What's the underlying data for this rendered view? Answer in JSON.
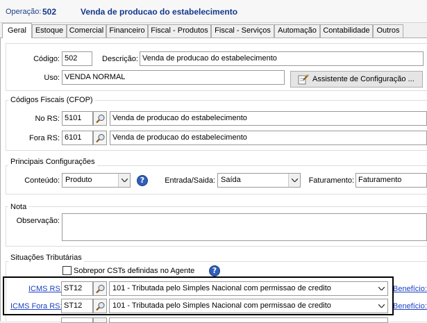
{
  "header": {
    "label": "Operação:",
    "code": "502",
    "title": "Venda de producao do estabelecimento"
  },
  "tabs": [
    {
      "label": "Geral",
      "active": true
    },
    {
      "label": "Estoque"
    },
    {
      "label": "Comercial"
    },
    {
      "label": "Financeiro"
    },
    {
      "label": "Fiscal - Produtos"
    },
    {
      "label": "Fiscal - Serviços"
    },
    {
      "label": "Automação"
    },
    {
      "label": "Contabilidade"
    },
    {
      "label": "Outros"
    }
  ],
  "general": {
    "codigo_label": "Código:",
    "codigo_value": "502",
    "descricao_label": "Descrição:",
    "descricao_value": "Venda de producao do estabelecimento",
    "uso_label": "Uso:",
    "uso_value": "VENDA NORMAL",
    "wizard_button": "Assistente de Configuração ..."
  },
  "cfop": {
    "title": "Códigos Fiscais (CFOP)",
    "no_rs_label": "No RS:",
    "no_rs_code": "5101",
    "no_rs_desc": "Venda de producao do estabelecimento",
    "fora_rs_label": "Fora RS:",
    "fora_rs_code": "6101",
    "fora_rs_desc": "Venda de producao do estabelecimento"
  },
  "config": {
    "title": "Principais Configurações",
    "conteudo_label": "Conteúdo:",
    "conteudo_value": "Produto",
    "entrada_saida_label": "Entrada/Saida:",
    "entrada_saida_value": "Saída",
    "faturamento_label": "Faturamento:",
    "faturamento_value": "Faturamento"
  },
  "nota": {
    "title": "Nota",
    "observacao_label": "Observação:",
    "observacao_value": ""
  },
  "situacoes": {
    "title": "Situações Tributárias",
    "sobrepor_label": "Sobrepor CSTs definidas no Agente",
    "sobrepor_checked": false,
    "icms_rs_label": "ICMS RS:",
    "icms_rs_code": "ST12",
    "icms_rs_desc": "101 - Tributada pelo Simples Nacional com permissao de credito",
    "icms_rs_beneficio": "Benefício:",
    "icms_fora_label": "ICMS Fora RS:",
    "icms_fora_code": "ST12",
    "icms_fora_desc": "101 - Tributada pelo Simples Nacional com permissao de credito",
    "icms_fora_beneficio": "Benefício:"
  },
  "colors": {
    "header_text": "#14368c",
    "link": "#1a3fc2",
    "help_icon": "#2f5fb8",
    "highlight_border": "#000000"
  }
}
